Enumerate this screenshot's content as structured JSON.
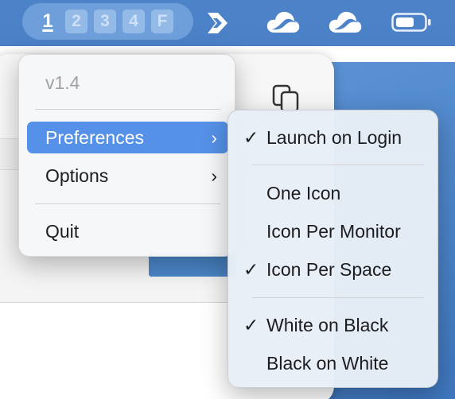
{
  "menubar": {
    "spaces": [
      {
        "label": "1",
        "active": true
      },
      {
        "label": "2",
        "active": false
      },
      {
        "label": "3",
        "active": false
      },
      {
        "label": "4",
        "active": false
      },
      {
        "label": "F",
        "active": false
      }
    ],
    "icons": [
      "app-logo-icon",
      "cloud-icon",
      "cloud-icon",
      "battery-icon"
    ]
  },
  "main_menu": {
    "version": "v1.4",
    "items": [
      {
        "label": "Preferences",
        "has_submenu": true,
        "highlighted": true
      },
      {
        "label": "Options",
        "has_submenu": true,
        "highlighted": false
      },
      {
        "label": "Quit",
        "has_submenu": false,
        "highlighted": false
      }
    ],
    "chevron": "›"
  },
  "submenu": {
    "check_glyph": "✓",
    "groups": [
      [
        {
          "label": "Launch on Login",
          "checked": true
        }
      ],
      [
        {
          "label": "One Icon",
          "checked": false
        },
        {
          "label": "Icon Per Monitor",
          "checked": false
        },
        {
          "label": "Icon Per Space",
          "checked": true
        }
      ],
      [
        {
          "label": "White on Black",
          "checked": true
        },
        {
          "label": "Black on White",
          "checked": false
        }
      ]
    ]
  },
  "colors": {
    "menubar": "#4d83c9",
    "highlight": "#5591e8",
    "space_active": "#ffffff",
    "space_inactive_bg": "#94bae8"
  }
}
